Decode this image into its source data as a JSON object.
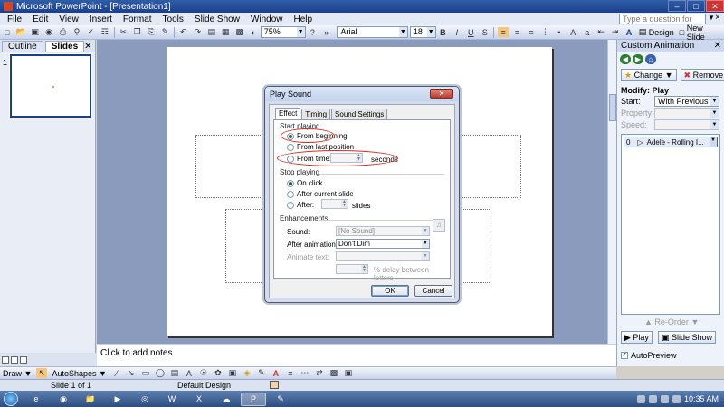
{
  "window": {
    "title": "Microsoft PowerPoint - [Presentation1]"
  },
  "menu": {
    "items": [
      "File",
      "Edit",
      "View",
      "Insert",
      "Format",
      "Tools",
      "Slide Show",
      "Window",
      "Help"
    ],
    "help_placeholder": "Type a question for help"
  },
  "toolbar": {
    "zoom": "75%",
    "font": "Arial",
    "font_size": "18",
    "design_label": "Design",
    "new_slide_label": "New Slide"
  },
  "left_pane": {
    "tabs": [
      "Outline",
      "Slides"
    ],
    "active_tab": "Slides",
    "slide_numbers": [
      "1"
    ]
  },
  "notes": {
    "placeholder": "Click to add notes"
  },
  "task_pane": {
    "title": "Custom Animation",
    "change_label": "Change",
    "remove_label": "Remove",
    "modify_heading": "Modify: Play",
    "start_label": "Start:",
    "start_value": "With Previous",
    "property_label": "Property:",
    "speed_label": "Speed:",
    "list_item_num": "0",
    "list_item_text": "Adele - Rolling I...",
    "reorder_label": "Re-Order",
    "play_label": "Play",
    "slideshow_label": "Slide Show",
    "autopreview_label": "AutoPreview"
  },
  "draw_bar": {
    "draw_label": "Draw",
    "autoshapes_label": "AutoShapes"
  },
  "status": {
    "slide": "Slide 1 of 1",
    "design": "Default Design"
  },
  "taskbar": {
    "clock": "10:35 AM"
  },
  "dialog": {
    "title": "Play Sound",
    "tabs": [
      "Effect",
      "Timing",
      "Sound Settings"
    ],
    "active_tab": "Effect",
    "start_group": "Start playing",
    "from_beginning": "From beginning",
    "from_last": "From last position",
    "from_time": "From time:",
    "seconds": "seconds",
    "stop_group": "Stop playing",
    "on_click": "On click",
    "after_current": "After current slide",
    "after": "After:",
    "slides": "slides",
    "enh_group": "Enhancements",
    "sound_label": "Sound:",
    "sound_value": "[No Sound]",
    "after_anim_label": "After animation:",
    "after_anim_value": "Don't Dim",
    "animate_text_label": "Animate text:",
    "delay_label": "% delay between letters",
    "ok": "OK",
    "cancel": "Cancel"
  },
  "colors": {
    "annotation": "#e0261e",
    "title_bar": "#1c3f8a",
    "slide_area": "#8a9bbd"
  }
}
